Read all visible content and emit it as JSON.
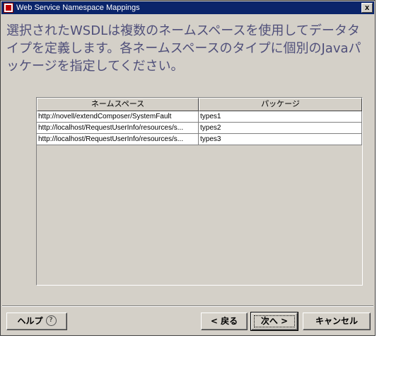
{
  "window": {
    "title": "Web Service Namespace Mappings",
    "close_label": "x"
  },
  "message": "選択されたWSDLは複数のネームスペースを使用してデータタイプを定義します。各ネームスペースのタイプに個別のJavaパッケージを指定してください。",
  "table": {
    "columns": [
      "ネームスペース",
      "パッケージ"
    ],
    "rows": [
      {
        "namespace": "http://novell/extendComposer/SystemFault",
        "package": "types1"
      },
      {
        "namespace": "http://localhost/RequestUserInfo/resources/s...",
        "package": "types2"
      },
      {
        "namespace": "http://localhost/RequestUserInfo/resources/s...",
        "package": "types3"
      }
    ]
  },
  "buttons": {
    "help": "ヘルプ",
    "help_icon": "?",
    "back": "< 戻る",
    "next": "次へ >",
    "cancel": "キャンセル"
  }
}
